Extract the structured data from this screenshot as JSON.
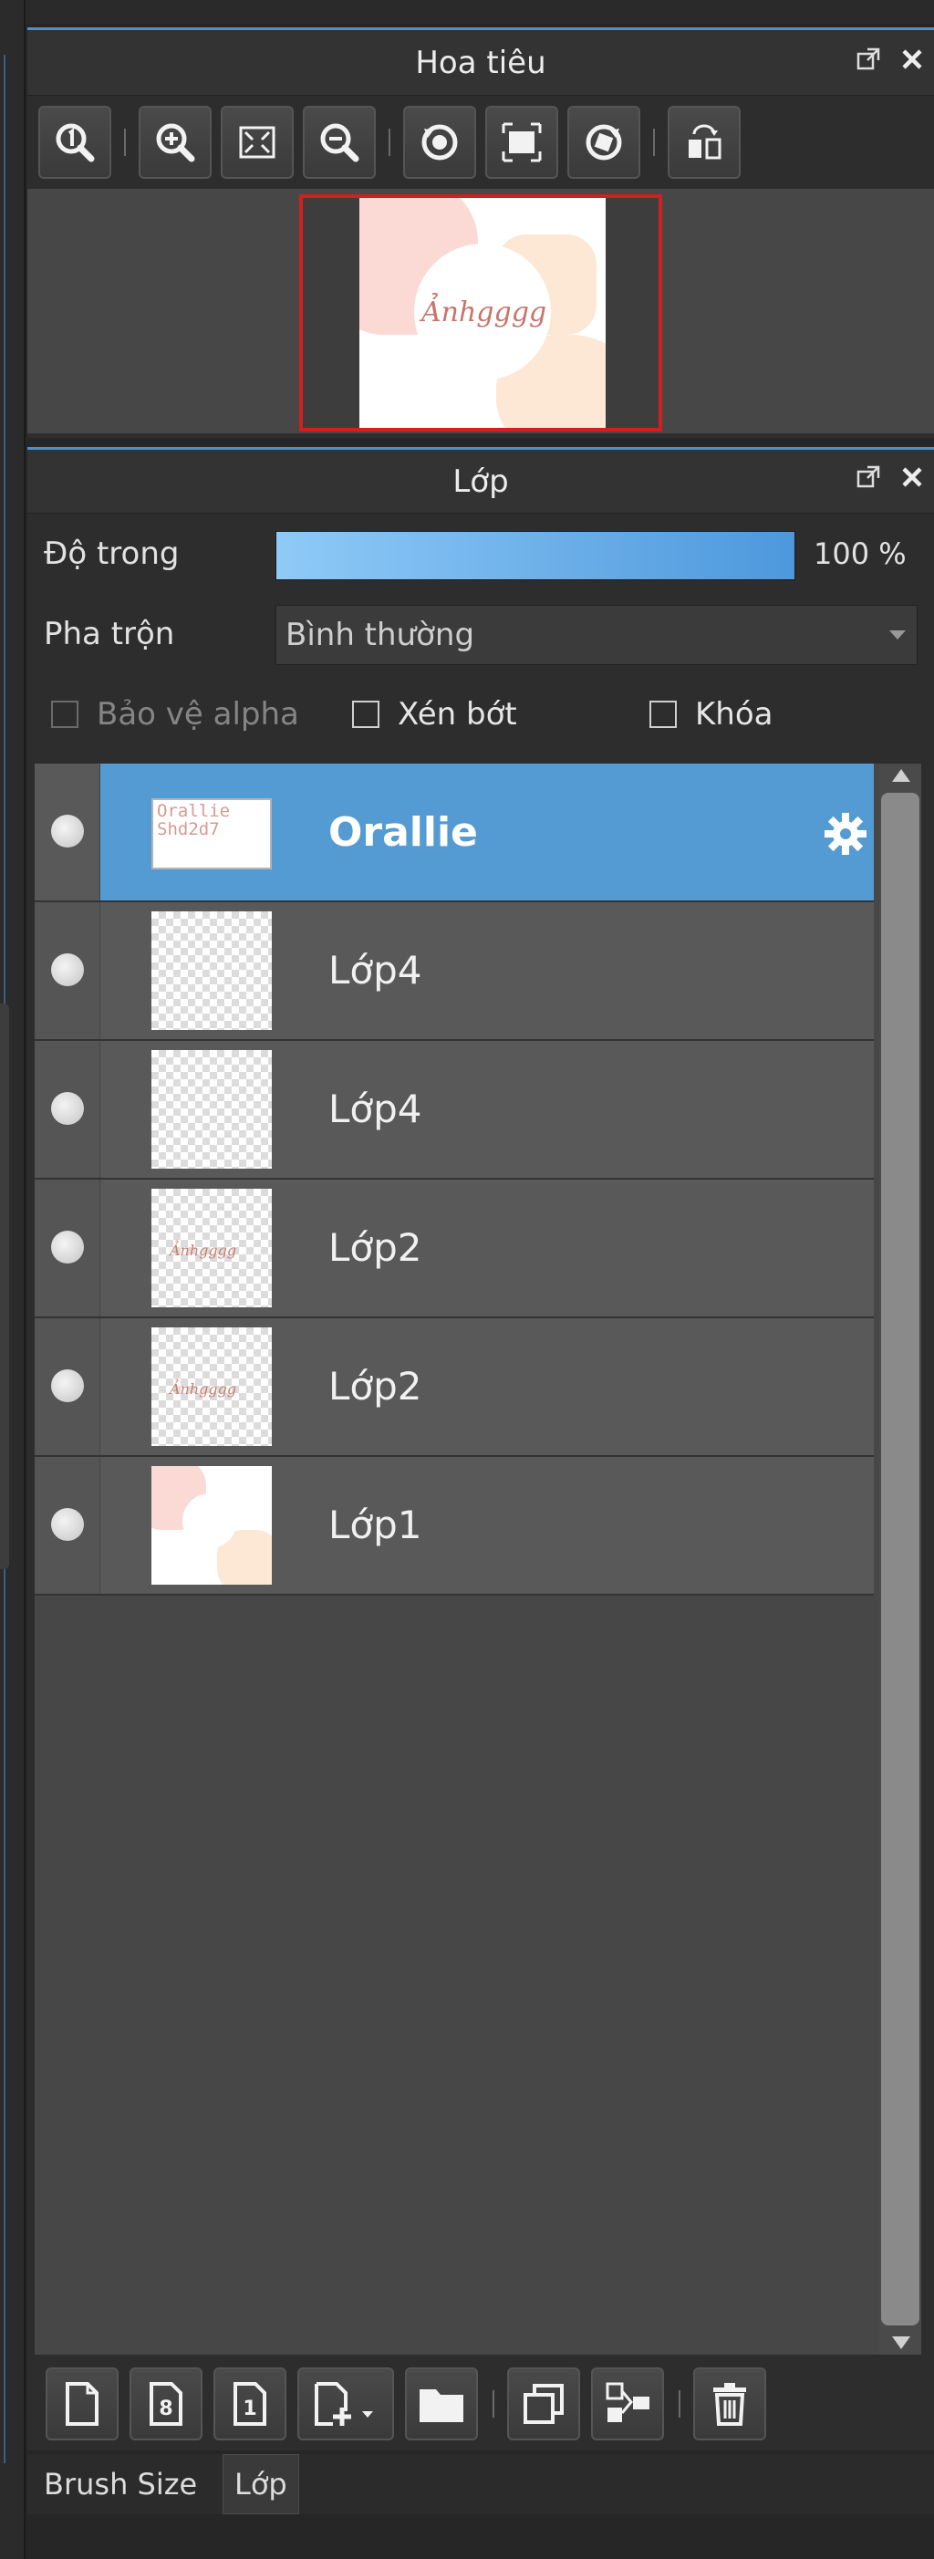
{
  "navigator": {
    "title": "Hoa tiêu",
    "preview_text": "Ảnhgggg",
    "toolbar": [
      "zoom-actual-icon",
      "zoom-in-icon",
      "fit-screen-icon",
      "zoom-out-icon",
      "rotate-left-icon",
      "reset-view-icon",
      "rotate-right-icon",
      "flip-horizontal-icon"
    ]
  },
  "layer_panel": {
    "title": "Lớp",
    "opacity": {
      "label": "Độ trong",
      "value": "100 %",
      "level": 1.0
    },
    "blend": {
      "label": "Pha trộn",
      "value": "Bình thường"
    },
    "checkboxes": {
      "protect_alpha": "Bảo vệ alpha",
      "clipping": "Xén bớt",
      "lock": "Khóa"
    },
    "layers": [
      {
        "name": "Orallie",
        "selected": true,
        "thumb_text": "Orallie Shd2d7"
      },
      {
        "name": "Lớp4",
        "selected": false,
        "thumb_text": ""
      },
      {
        "name": "Lớp4",
        "selected": false,
        "thumb_text": ""
      },
      {
        "name": "Lớp2",
        "selected": false,
        "thumb_text": "Ảnhgggg"
      },
      {
        "name": "Lớp2",
        "selected": false,
        "thumb_text": "Ảnhgggg"
      },
      {
        "name": "Lớp1",
        "selected": false,
        "thumb_text": ""
      }
    ],
    "bottom_toolbar": [
      "new-layer-icon",
      "new-8bit-layer-icon",
      "new-1bit-layer-icon",
      "add-layer-menu-icon",
      "folder-icon",
      "duplicate-layer-icon",
      "merge-down-icon",
      "delete-layer-icon"
    ]
  },
  "tabs": [
    "Brush Size",
    "Lớp"
  ],
  "colors": {
    "accent": "#549bd4",
    "selected_border": "#d21f1f",
    "panel_bg": "#2d2d2d",
    "list_bg": "#474747"
  }
}
